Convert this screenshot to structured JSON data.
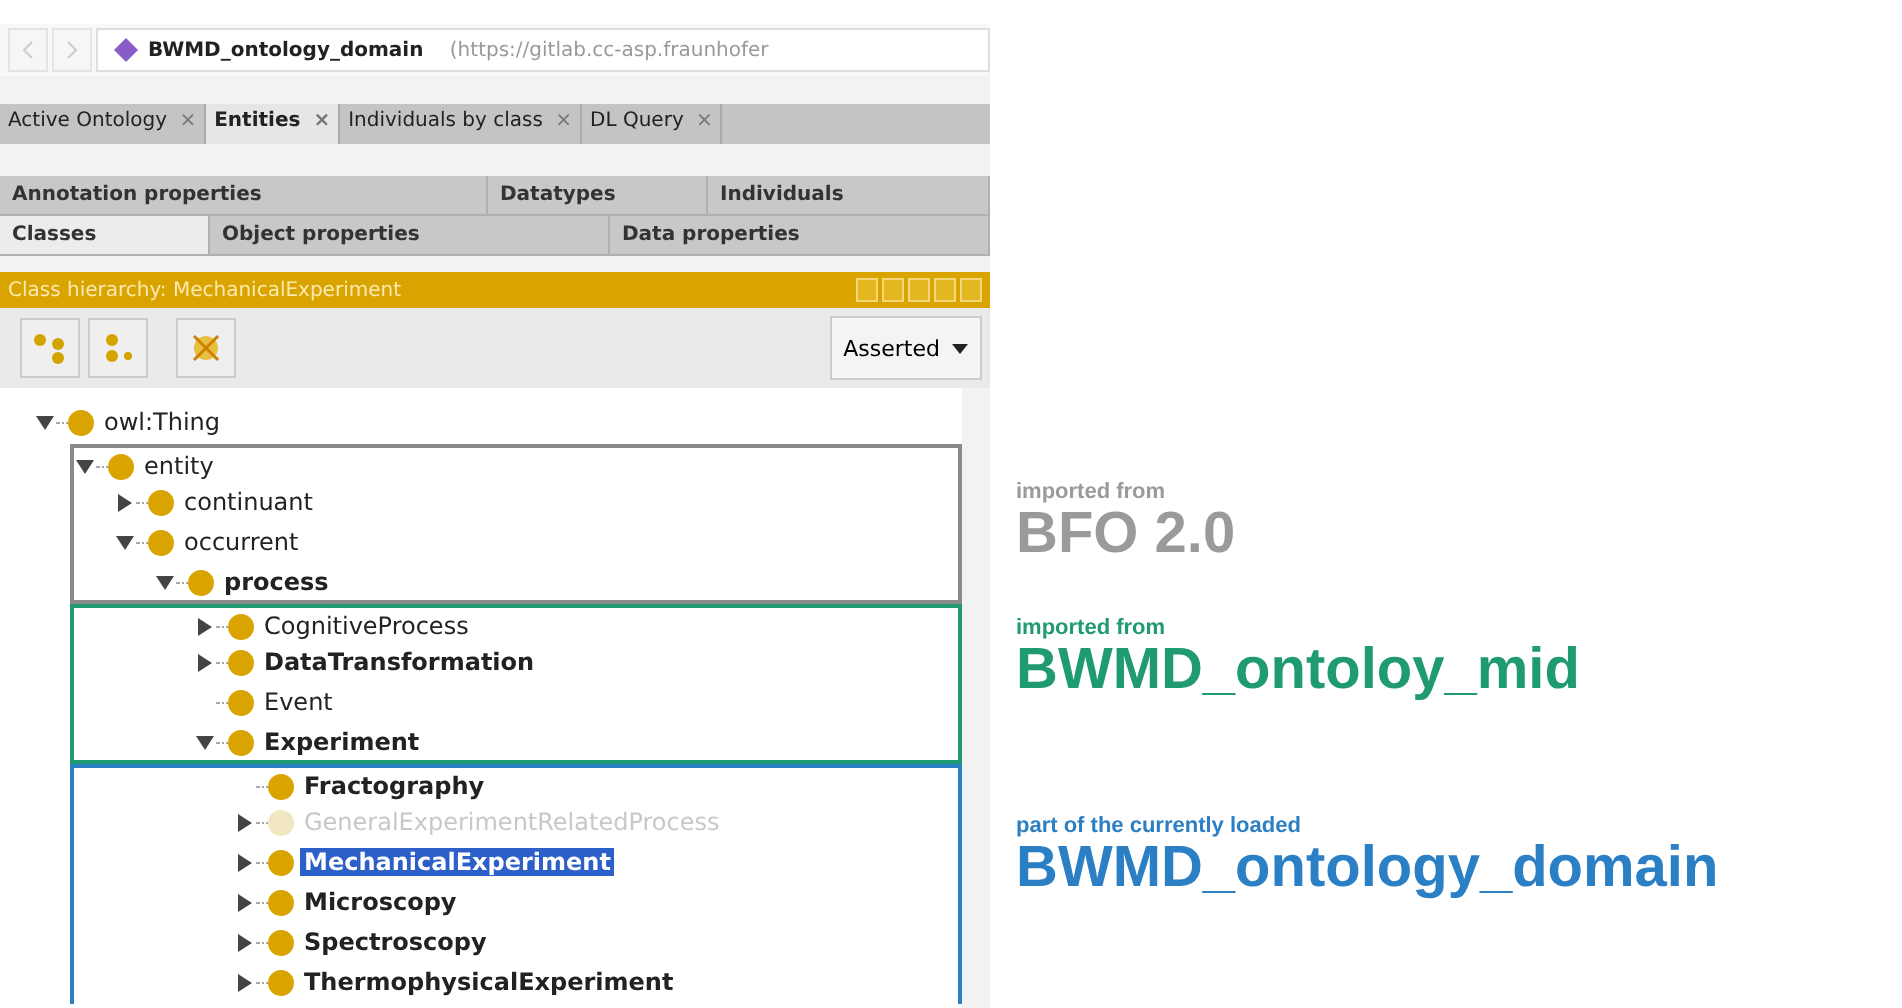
{
  "address_bar": {
    "ontology": "BWMD_ontology_domain",
    "url": "(https://gitlab.cc-asp.fraunhofer"
  },
  "tabs": [
    {
      "label": "Active Ontology",
      "close": "×",
      "selected": false
    },
    {
      "label": "Entities",
      "close": "×",
      "selected": true
    },
    {
      "label": "Individuals by class",
      "close": "×",
      "selected": false
    },
    {
      "label": "DL Query",
      "close": "×",
      "selected": false
    }
  ],
  "entity_tabs_row_1": [
    {
      "label": "Annotation properties",
      "selected": false
    },
    {
      "label": "Datatypes",
      "selected": false
    },
    {
      "label": "Individuals",
      "selected": false
    }
  ],
  "entity_tabs_row_2": [
    {
      "label": "Classes",
      "selected": true
    },
    {
      "label": "Object properties",
      "selected": false
    },
    {
      "label": "Data properties",
      "selected": false
    }
  ],
  "panel": {
    "title": "Class hierarchy: MechanicalExperiment",
    "view_dropdown": "Asserted"
  },
  "tree": [
    {
      "label": "owl:Thing",
      "has_toggle": true,
      "expanded": true,
      "bold": false,
      "greyed": false,
      "selected": false,
      "children": [
        {
          "label": "entity",
          "has_toggle": true,
          "expanded": true,
          "bold": false,
          "greyed": false,
          "selected": false,
          "color": "#8a8a8a",
          "children": [
            {
              "label": "continuant",
              "has_toggle": true,
              "expanded": false,
              "bold": false,
              "greyed": false,
              "selected": false,
              "color": "#8a8a8a"
            },
            {
              "label": "occurrent",
              "has_toggle": true,
              "expanded": true,
              "bold": false,
              "greyed": false,
              "selected": false,
              "color": "#8a8a8a",
              "children": [
                {
                  "label": "process",
                  "has_toggle": true,
                  "expanded": true,
                  "bold": true,
                  "greyed": false,
                  "selected": false,
                  "color": "#8a8a8a",
                  "children": [
                    {
                      "label": "CognitiveProcess",
                      "has_toggle": true,
                      "expanded": false,
                      "bold": false,
                      "greyed": false,
                      "selected": false,
                      "color": "#1f9a72"
                    },
                    {
                      "label": "DataTransformation",
                      "has_toggle": true,
                      "expanded": false,
                      "bold": true,
                      "greyed": false,
                      "selected": false,
                      "color": "#1f9a72"
                    },
                    {
                      "label": "Event",
                      "has_toggle": false,
                      "bold": false,
                      "greyed": false,
                      "selected": false,
                      "color": "#1f9a72"
                    },
                    {
                      "label": "Experiment",
                      "has_toggle": true,
                      "expanded": true,
                      "bold": true,
                      "greyed": false,
                      "selected": false,
                      "color": "#1f9a72",
                      "children": [
                        {
                          "label": "Fractography",
                          "has_toggle": false,
                          "bold": true,
                          "greyed": false,
                          "selected": false,
                          "color": "#2b7fc4"
                        },
                        {
                          "label": "GeneralExperimentRelatedProcess",
                          "has_toggle": true,
                          "expanded": false,
                          "bold": false,
                          "greyed": true,
                          "selected": false,
                          "color": "#2b7fc4"
                        },
                        {
                          "label": "MechanicalExperiment",
                          "has_toggle": true,
                          "expanded": false,
                          "bold": true,
                          "greyed": false,
                          "selected": true,
                          "color": "#2b7fc4"
                        },
                        {
                          "label": "Microscopy",
                          "has_toggle": true,
                          "expanded": false,
                          "bold": true,
                          "greyed": false,
                          "selected": false,
                          "color": "#2b7fc4"
                        },
                        {
                          "label": "Spectroscopy",
                          "has_toggle": true,
                          "expanded": false,
                          "bold": true,
                          "greyed": false,
                          "selected": false,
                          "color": "#2b7fc4"
                        },
                        {
                          "label": "ThermophysicalExperiment",
                          "has_toggle": true,
                          "expanded": false,
                          "bold": true,
                          "greyed": false,
                          "selected": false,
                          "color": "#2b7fc4"
                        }
                      ]
                    }
                  ]
                }
              ]
            }
          ]
        }
      ]
    }
  ],
  "annotations": [
    {
      "caption": "imported from",
      "name": "BFO 2.0",
      "color": "#9a9a9a"
    },
    {
      "caption": "imported from",
      "name": "BWMD_ontoloy_mid",
      "color": "#1f9a72"
    },
    {
      "caption": "part of the currently loaded",
      "name": "BWMD_ontology_domain",
      "color": "#2b7fc4"
    }
  ]
}
